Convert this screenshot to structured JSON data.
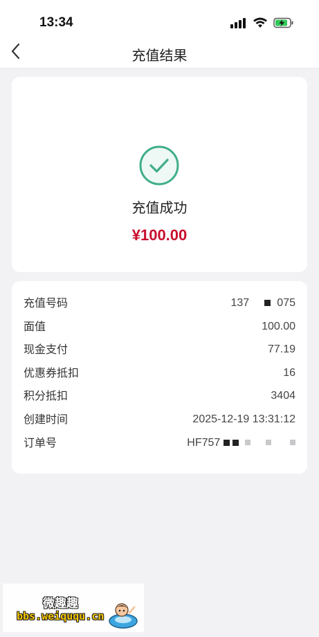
{
  "status_bar": {
    "time": "13:34"
  },
  "nav": {
    "title": "充值结果"
  },
  "result": {
    "status": "充值成功",
    "amount": "¥100.00",
    "accent_color": "#c8102e",
    "icon_color": "#3fae8a"
  },
  "details": [
    {
      "label": "充值号码",
      "value_prefix": "137",
      "value_suffix": "075"
    },
    {
      "label": "面值",
      "value": "100.00"
    },
    {
      "label": "现金支付",
      "value": "77.19"
    },
    {
      "label": "优惠券抵扣",
      "value": "16"
    },
    {
      "label": "积分抵扣",
      "value": "3404"
    },
    {
      "label": "创建时间",
      "value": "2025-12-19 13:31:12"
    },
    {
      "label": "订单号",
      "value_prefix": "HF757"
    }
  ],
  "watermark": {
    "title": "微趣趣",
    "url": "bbs.weiququ.cn"
  }
}
